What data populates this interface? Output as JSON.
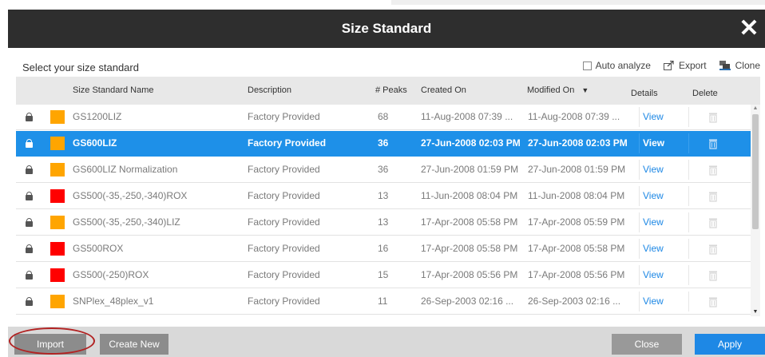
{
  "dialog": {
    "title": "Size Standard",
    "close_glyph": "✕",
    "subtitle": "Select your size standard"
  },
  "toolbar": {
    "auto_analyze_label": "Auto analyze",
    "auto_analyze_checked": false,
    "export_label": "Export",
    "clone_label": "Clone"
  },
  "table": {
    "headers": {
      "name": "Size Standard Name",
      "description": "Description",
      "peaks": "# Peaks",
      "created": "Created On",
      "modified": "Modified On",
      "sort_indicator": "▼",
      "details": "Details",
      "delete": "Delete"
    },
    "rows": [
      {
        "name": "GS1200LIZ",
        "color": "#ffa500",
        "description": "Factory Provided",
        "peaks": "68",
        "created": "11-Aug-2008 07:39 ...",
        "modified": "11-Aug-2008 07:39 ...",
        "details": "View",
        "selected": false
      },
      {
        "name": "GS600LIZ",
        "color": "#ffa500",
        "description": "Factory Provided",
        "peaks": "36",
        "created": "27-Jun-2008 02:03 PM",
        "modified": "27-Jun-2008 02:03 PM",
        "details": "View",
        "selected": true
      },
      {
        "name": "GS600LIZ Normalization",
        "color": "#ffa500",
        "description": "Factory Provided",
        "peaks": "36",
        "created": "27-Jun-2008 01:59 PM",
        "modified": "27-Jun-2008 01:59 PM",
        "details": "View",
        "selected": false
      },
      {
        "name": "GS500(-35,-250,-340)ROX",
        "color": "#ff0000",
        "description": "Factory Provided",
        "peaks": "13",
        "created": "11-Jun-2008 08:04 PM",
        "modified": "11-Jun-2008 08:04 PM",
        "details": "View",
        "selected": false
      },
      {
        "name": "GS500(-35,-250,-340)LIZ",
        "color": "#ffa500",
        "description": "Factory Provided",
        "peaks": "13",
        "created": "17-Apr-2008 05:58 PM",
        "modified": "17-Apr-2008 05:59 PM",
        "details": "View",
        "selected": false
      },
      {
        "name": "GS500ROX",
        "color": "#ff0000",
        "description": "Factory Provided",
        "peaks": "16",
        "created": "17-Apr-2008 05:58 PM",
        "modified": "17-Apr-2008 05:58 PM",
        "details": "View",
        "selected": false
      },
      {
        "name": "GS500(-250)ROX",
        "color": "#ff0000",
        "description": "Factory Provided",
        "peaks": "15",
        "created": "17-Apr-2008 05:56 PM",
        "modified": "17-Apr-2008 05:56 PM",
        "details": "View",
        "selected": false
      },
      {
        "name": "SNPlex_48plex_v1",
        "color": "#ffa500",
        "description": "Factory Provided",
        "peaks": "11",
        "created": "26-Sep-2003 02:16 ...",
        "modified": "26-Sep-2003 02:16 ...",
        "details": "View",
        "selected": false
      }
    ]
  },
  "footer": {
    "import_label": "Import",
    "create_new_label": "Create New",
    "close_label": "Close",
    "apply_label": "Apply"
  },
  "colors": {
    "selection": "#1e90e8",
    "link": "#1e88e5",
    "title_bar": "#2e2e2e",
    "apply_button": "#1e88e5",
    "secondary_button": "#999999",
    "import_highlight": "#b22222"
  },
  "icons": {
    "lock": "lock-icon",
    "trash": "trash-icon",
    "export": "export-icon",
    "clone": "clone-icon"
  }
}
